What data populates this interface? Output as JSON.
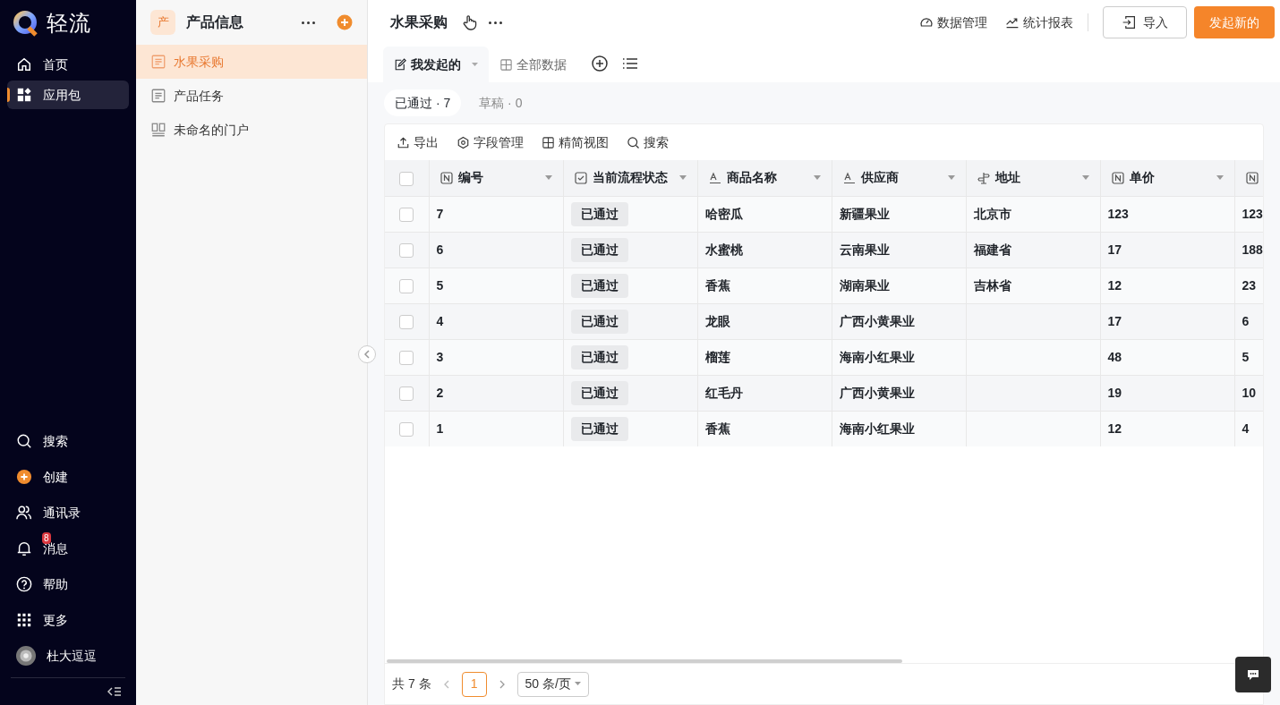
{
  "app": {
    "name": "轻流"
  },
  "nav": [
    {
      "label": "首页",
      "kind": "home",
      "selected": false
    },
    {
      "label": "应用包",
      "kind": "apps",
      "selected": true
    }
  ],
  "nav_bottom": [
    {
      "label": "搜索",
      "kind": "search"
    },
    {
      "label": "创建",
      "kind": "create"
    },
    {
      "label": "通讯录",
      "kind": "contacts"
    },
    {
      "label": "消息",
      "kind": "bell",
      "badge": "8"
    },
    {
      "label": "帮助",
      "kind": "help"
    },
    {
      "label": "更多",
      "kind": "more"
    },
    {
      "label": "杜大逗逗",
      "kind": "avatar"
    }
  ],
  "package": {
    "badge": "产",
    "title": "产品信息",
    "items": [
      {
        "label": "水果采购",
        "kind": "form",
        "selected": true
      },
      {
        "label": "产品任务",
        "kind": "form",
        "selected": false
      },
      {
        "label": "未命名的门户",
        "kind": "portal",
        "selected": false
      }
    ]
  },
  "header": {
    "title": "水果采购",
    "links": [
      {
        "label": "数据管理",
        "kind": "gauge"
      },
      {
        "label": "统计报表",
        "kind": "trend"
      }
    ],
    "import_button": "导入",
    "primary_button": "发起新的"
  },
  "views": [
    {
      "label": "我发起的",
      "kind": "edit",
      "selected": true
    },
    {
      "label": "全部数据",
      "kind": "grid",
      "selected": false
    }
  ],
  "filters": [
    {
      "label": "已通过 · 7",
      "selected": true
    },
    {
      "label": "草稿 · 0",
      "selected": false
    }
  ],
  "toolbar": [
    {
      "label": "导出",
      "kind": "upload"
    },
    {
      "label": "字段管理",
      "kind": "gear"
    },
    {
      "label": "精简视图",
      "kind": "grid"
    },
    {
      "label": "搜索",
      "kind": "search"
    }
  ],
  "table": {
    "select_all_checked": false,
    "columns": [
      {
        "label": "编号",
        "kind": "number"
      },
      {
        "label": "当前流程状态",
        "kind": "status"
      },
      {
        "label": "商品名称",
        "kind": "text"
      },
      {
        "label": "供应商",
        "kind": "text"
      },
      {
        "label": "地址",
        "kind": "location"
      },
      {
        "label": "单价",
        "kind": "number"
      },
      {
        "kind": "number"
      }
    ],
    "rows": [
      {
        "checked": false,
        "cells": [
          "7",
          "已通过",
          "哈密瓜",
          "新疆果业",
          "北京市",
          "123",
          "123"
        ]
      },
      {
        "checked": false,
        "cells": [
          "6",
          "已通过",
          "水蜜桃",
          "云南果业",
          "福建省",
          "17",
          "188"
        ]
      },
      {
        "checked": false,
        "cells": [
          "5",
          "已通过",
          "香蕉",
          "湖南果业",
          "吉林省",
          "12",
          "23"
        ]
      },
      {
        "checked": false,
        "cells": [
          "4",
          "已通过",
          "龙眼",
          "广西小黄果业",
          null,
          "17",
          "6"
        ]
      },
      {
        "checked": false,
        "cells": [
          "3",
          "已通过",
          "榴莲",
          "海南小红果业",
          null,
          "48",
          "5"
        ]
      },
      {
        "checked": false,
        "cells": [
          "2",
          "已通过",
          "红毛丹",
          "广西小黄果业",
          null,
          "19",
          "10"
        ]
      },
      {
        "checked": false,
        "cells": [
          "1",
          "已通过",
          "香蕉",
          "海南小红果业",
          null,
          "12",
          "4"
        ]
      }
    ]
  },
  "pagination": {
    "total": "共 7 条",
    "page": "1",
    "page_size": "50 条/页"
  }
}
